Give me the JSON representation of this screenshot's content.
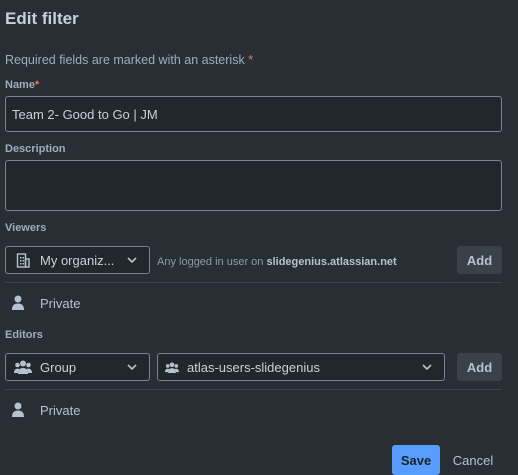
{
  "dialog": {
    "title": "Edit filter",
    "required_note": "Required fields are marked with an asterisk",
    "asterisk": "*"
  },
  "name": {
    "label": "Name",
    "value": "Team 2- Good to Go | JM"
  },
  "description": {
    "label": "Description",
    "value": ""
  },
  "viewers": {
    "label": "Viewers",
    "scope_selected": "My organiz...",
    "scope_icon": "building-icon",
    "hint_prefix": "Any logged in user on",
    "hint_site": "slidegenius.atlassian.net",
    "add_label": "Add",
    "current_entry": {
      "label": "Private",
      "icon": "person-icon"
    }
  },
  "editors": {
    "label": "Editors",
    "type_selected": "Group",
    "type_icon": "people-icon",
    "group_selected": "atlas-users-slidegenius",
    "group_icon": "people-icon",
    "add_label": "Add",
    "current_entry": {
      "label": "Private",
      "icon": "person-icon"
    }
  },
  "footer": {
    "save_label": "Save",
    "cancel_label": "Cancel"
  },
  "colors": {
    "background": "#282e33",
    "primary": "#579dff",
    "required_star": "#f87168"
  }
}
